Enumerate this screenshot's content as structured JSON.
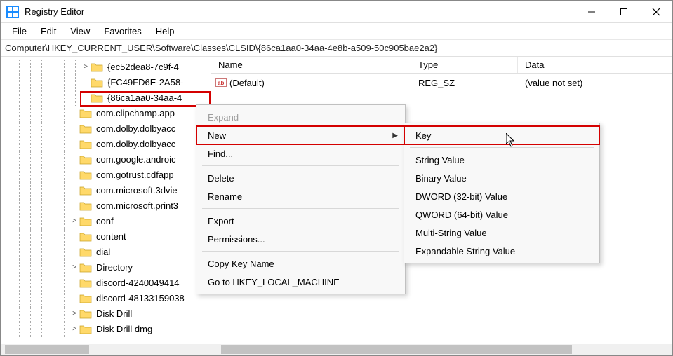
{
  "window": {
    "title": "Registry Editor"
  },
  "menu": {
    "file": "File",
    "edit": "Edit",
    "view": "View",
    "favorites": "Favorites",
    "help": "Help"
  },
  "address": "Computer\\HKEY_CURRENT_USER\\Software\\Classes\\CLSID\\{86ca1aa0-34aa-4e8b-a509-50c905bae2a2}",
  "tree": {
    "items": [
      {
        "expander": ">",
        "label": "{ec52dea8-7c9f-4",
        "indent": 8
      },
      {
        "expander": "",
        "label": "{FC49FD6E-2A58-",
        "indent": 8
      },
      {
        "expander": "",
        "label": "{86ca1aa0-34aa-4",
        "indent": 8,
        "selected": true
      },
      {
        "expander": "",
        "label": "com.clipchamp.app",
        "indent": 7
      },
      {
        "expander": "",
        "label": "com.dolby.dolbyacc",
        "indent": 7
      },
      {
        "expander": "",
        "label": "com.dolby.dolbyacc",
        "indent": 7
      },
      {
        "expander": "",
        "label": "com.google.androic",
        "indent": 7
      },
      {
        "expander": "",
        "label": "com.gotrust.cdfapp",
        "indent": 7
      },
      {
        "expander": "",
        "label": "com.microsoft.3dvie",
        "indent": 7
      },
      {
        "expander": "",
        "label": "com.microsoft.print3",
        "indent": 7
      },
      {
        "expander": ">",
        "label": "conf",
        "indent": 7
      },
      {
        "expander": "",
        "label": "content",
        "indent": 7
      },
      {
        "expander": "",
        "label": "dial",
        "indent": 7
      },
      {
        "expander": ">",
        "label": "Directory",
        "indent": 7
      },
      {
        "expander": "",
        "label": "discord-4240049414",
        "indent": 7
      },
      {
        "expander": "",
        "label": "discord-48133159038",
        "indent": 7
      },
      {
        "expander": ">",
        "label": "Disk Drill",
        "indent": 7
      },
      {
        "expander": ">",
        "label": "Disk Drill dmg",
        "indent": 7
      }
    ]
  },
  "list": {
    "columns": {
      "name": "Name",
      "type": "Type",
      "data": "Data"
    },
    "rows": [
      {
        "name": "(Default)",
        "type": "REG_SZ",
        "data": "(value not set)"
      }
    ]
  },
  "context_menu": {
    "expand": "Expand",
    "new": "New",
    "find": "Find...",
    "delete": "Delete",
    "rename": "Rename",
    "export": "Export",
    "permissions": "Permissions...",
    "copy_key_name": "Copy Key Name",
    "goto_hklm": "Go to HKEY_LOCAL_MACHINE"
  },
  "submenu": {
    "key": "Key",
    "string": "String Value",
    "binary": "Binary Value",
    "dword": "DWORD (32-bit) Value",
    "qword": "QWORD (64-bit) Value",
    "multi_string": "Multi-String Value",
    "expandable_string": "Expandable String Value"
  }
}
